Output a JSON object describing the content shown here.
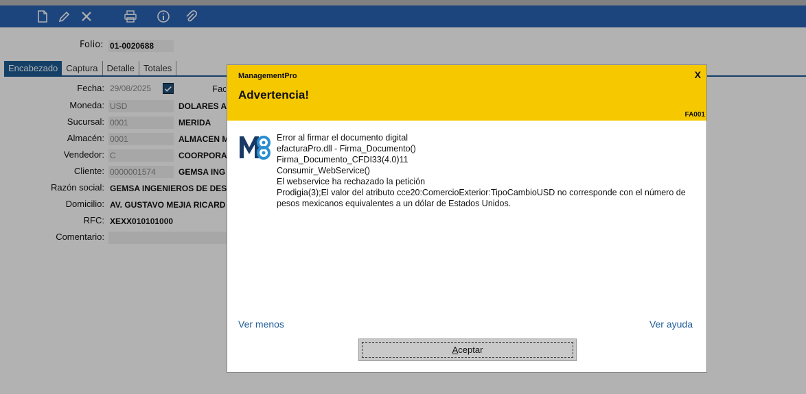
{
  "toolbar": {
    "icons": [
      "new-document-icon",
      "edit-pencil-icon",
      "delete-x-icon",
      "print-icon",
      "info-icon",
      "attach-clip-icon"
    ]
  },
  "header": {
    "folio_label": "Folio:",
    "folio_value": "01-0020688"
  },
  "tabs": [
    {
      "label": "Encabezado"
    },
    {
      "label": "Captura"
    },
    {
      "label": "Detalle"
    },
    {
      "label": "Totales"
    }
  ],
  "form": {
    "fecha_label": "Fecha:",
    "fecha_value": "29/08/2025",
    "fac_label": "Fac",
    "moneda_label": "Moneda:",
    "moneda_code": "USD",
    "moneda_name": "DOLARES A",
    "sucursal_label": "Sucursal:",
    "sucursal_code": "0001",
    "sucursal_name": "MERIDA",
    "almacen_label": "Almacén:",
    "almacen_code": "0001",
    "almacen_name": "ALMACEN M",
    "vendedor_label": "Vendedor:",
    "vendedor_code": "C",
    "vendedor_name": "COORPORA",
    "cliente_label": "Cliente:",
    "cliente_code": "0000001574",
    "cliente_name": "GEMSA ING",
    "razon_label": "Razón social:",
    "razon_value": "GEMSA INGENIEROS DE DES",
    "domicilio_label": "Domicilio:",
    "domicilio_value": "AV. GUSTAVO MEJIA RICARD",
    "rfc_label": "RFC:",
    "rfc_value": "XEXX010101000",
    "comentario_label": "Comentario:",
    "comentario_value": ""
  },
  "dialog": {
    "app_name": "ManagementPro",
    "title": "Advertencia!",
    "close_label": "X",
    "code": "FA001",
    "message_lines": [
      "Error al firmar el documento digital",
      "efacturaPro.dll - Firma_Documento()",
      "Firma_Documento_CFDI33(4.0)11",
      "Consumir_WebService()",
      "El webservice ha rechazado la petición",
      "Prodigia(3);El valor del atributo cce20:ComercioExterior:TipoCambioUSD no corresponde con el número de pesos mexicanos equivalentes a un dólar de Estados Unidos."
    ],
    "ver_menos": "Ver menos",
    "ver_ayuda": "Ver ayuda",
    "accept_first": "A",
    "accept_rest": "ceptar"
  },
  "colors": {
    "toolbar": "#2a63b3",
    "dialog_header": "#f6c800",
    "link": "#1d5c96",
    "tab_active": "#1d5c96"
  }
}
